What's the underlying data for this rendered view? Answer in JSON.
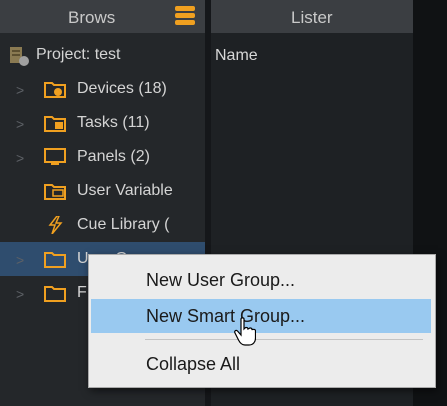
{
  "browser": {
    "title": "Brows",
    "project": "Project: test",
    "items": [
      {
        "label": "Devices (18)",
        "icon": "devices-folder-icon"
      },
      {
        "label": "Tasks (11)",
        "icon": "tasks-folder-icon"
      },
      {
        "label": "Panels (2)",
        "icon": "panels-icon"
      },
      {
        "label": "User Variable",
        "icon": "user-variables-icon"
      },
      {
        "label": "Cue Library (",
        "icon": "cue-library-icon"
      },
      {
        "label": "User Groups",
        "icon": "user-groups-folder-icon"
      },
      {
        "label": "F",
        "icon": "folder-icon"
      }
    ]
  },
  "lister": {
    "title": "Lister",
    "column_name": "Name"
  },
  "context_menu": {
    "items": [
      {
        "label": "New User Group..."
      },
      {
        "label": "New Smart Group..."
      },
      {
        "label": "Collapse All"
      }
    ]
  },
  "colors": {
    "accent": "#f0a020",
    "selection": "#2f4d6e",
    "menu_hover": "#99c9f0"
  }
}
